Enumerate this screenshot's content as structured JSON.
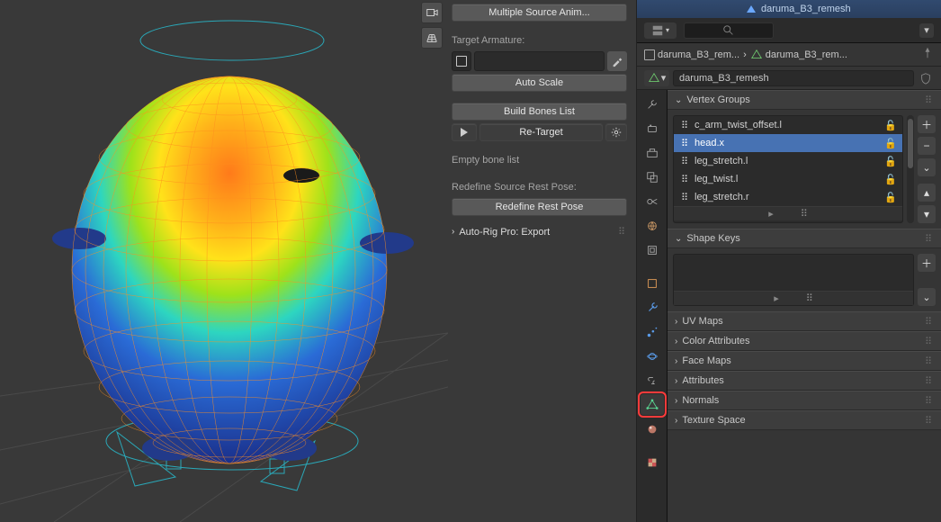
{
  "midpanel": {
    "multi_source_button": "Multiple Source Anim...",
    "target_armature_label": "Target Armature:",
    "auto_scale_button": "Auto Scale",
    "build_bones_button": "Build Bones List",
    "retarget_button": "Re-Target",
    "empty_bone_list": "Empty bone list",
    "redefine_label": "Redefine Source Rest Pose:",
    "redefine_button": "Redefine Rest Pose",
    "export_section": "Auto-Rig Pro: Export"
  },
  "outliner": {
    "active_object": "daruma_B3_remesh"
  },
  "breadcrumb": {
    "item1": "daruma_B3_rem...",
    "item2": "daruma_B3_rem..."
  },
  "object_name": "daruma_B3_remesh",
  "vertex_groups": {
    "header": "Vertex Groups",
    "items": [
      {
        "name": "c_arm_twist_offset.l",
        "selected": false
      },
      {
        "name": "head.x",
        "selected": true
      },
      {
        "name": "leg_stretch.l",
        "selected": false
      },
      {
        "name": "leg_twist.l",
        "selected": false
      },
      {
        "name": "leg_stretch.r",
        "selected": false
      }
    ]
  },
  "shape_keys": {
    "header": "Shape Keys"
  },
  "panels": {
    "uv": "UV Maps",
    "color_attrs": "Color Attributes",
    "face_maps": "Face Maps",
    "attributes": "Attributes",
    "normals": "Normals",
    "texture_space": "Texture Space"
  }
}
